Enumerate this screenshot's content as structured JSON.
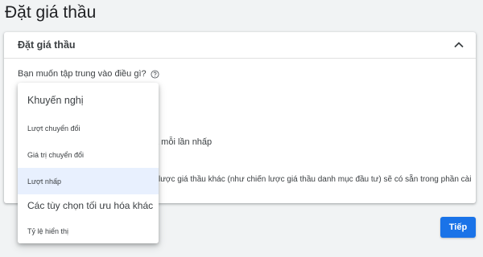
{
  "page": {
    "title": "Đặt giá thầu"
  },
  "card": {
    "title": "Đặt giá thầu",
    "question": "Bạn muốn tập trung vào điều gì?",
    "bg_text_1": "a mỗi lần nhấp",
    "bg_text_2": "lược giá thầu khác (như chiến lược giá thầu danh mục đầu tư) sẽ có sẵn trong phần cài"
  },
  "dropdown": {
    "header": "Khuyến nghị",
    "items": [
      {
        "label": "Lượt chuyển đổi"
      },
      {
        "label": "Giá trị chuyển đổi"
      },
      {
        "label": "Lượt nhấp"
      }
    ],
    "group_header": "Các tùy chọn tối ưu hóa khác",
    "other_items": [
      {
        "label": "Tỷ lệ hiển thị"
      }
    ]
  },
  "buttons": {
    "next": "Tiếp"
  },
  "colors": {
    "accent": "#1a73e8",
    "selected_bg": "#e8f0fe",
    "checkbox_edge": "#f29900"
  }
}
